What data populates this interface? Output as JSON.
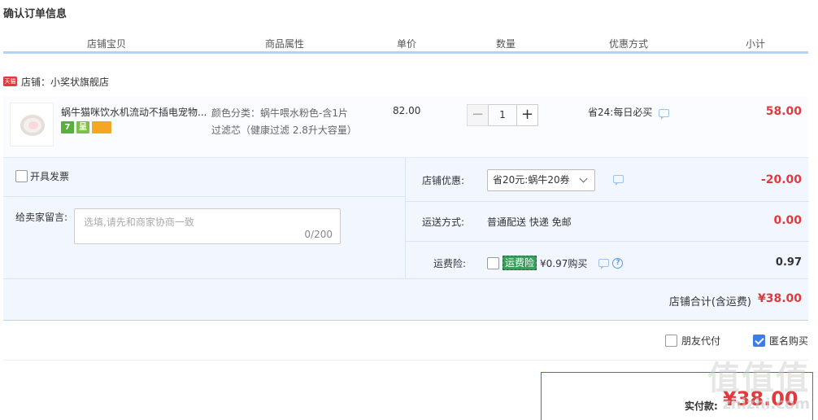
{
  "page": {
    "title": "确认订单信息"
  },
  "columns": [
    "店铺宝贝",
    "商品属性",
    "单价",
    "数量",
    "优惠方式",
    "小计"
  ],
  "shop": {
    "badge": "天猫",
    "label": "店铺：小奖状旗舰店"
  },
  "item": {
    "title": "蜗牛猫咪饮水机流动不插电宠物...",
    "tags": [
      "7",
      "呈",
      ""
    ],
    "attr_line1": "颜色分类：蜗牛喂水粉色-含1片",
    "attr_line2": "过滤芯（健康过滤 2.8升大容量）",
    "unit_price": "82.00",
    "quantity": "1",
    "qty_minus": "−",
    "qty_plus": "+",
    "promo": "省24:每日必买",
    "subtotal": "58.00"
  },
  "options": {
    "invoice_label": "开具发票",
    "message_label": "给卖家留言:",
    "message_placeholder": "选填,请先和商家协商一致",
    "message_count": "0/200",
    "store_discount_label": "店铺优惠:",
    "store_discount_value": "省20元:蜗牛20券",
    "store_discount_amount": "-20.00",
    "shipping_label": "运送方式:",
    "shipping_value": "普通配送 快递 免邮",
    "shipping_amount": "0.00",
    "insurance_label": "运费险:",
    "insurance_tag": "运费险",
    "insurance_price": "¥0.97购买",
    "insurance_amount": "0.97",
    "total_label": "店铺合计(含运费)",
    "total_amount": "¥38.00"
  },
  "extras": {
    "friend_pay": "朋友代付",
    "anonymous": "匿名购买",
    "anonymous_checked": true
  },
  "payment": {
    "label": "实付款:",
    "amount": "¥38.00"
  },
  "watermark": {
    "top": "值值值",
    "bottom": "zhizhi.com"
  }
}
